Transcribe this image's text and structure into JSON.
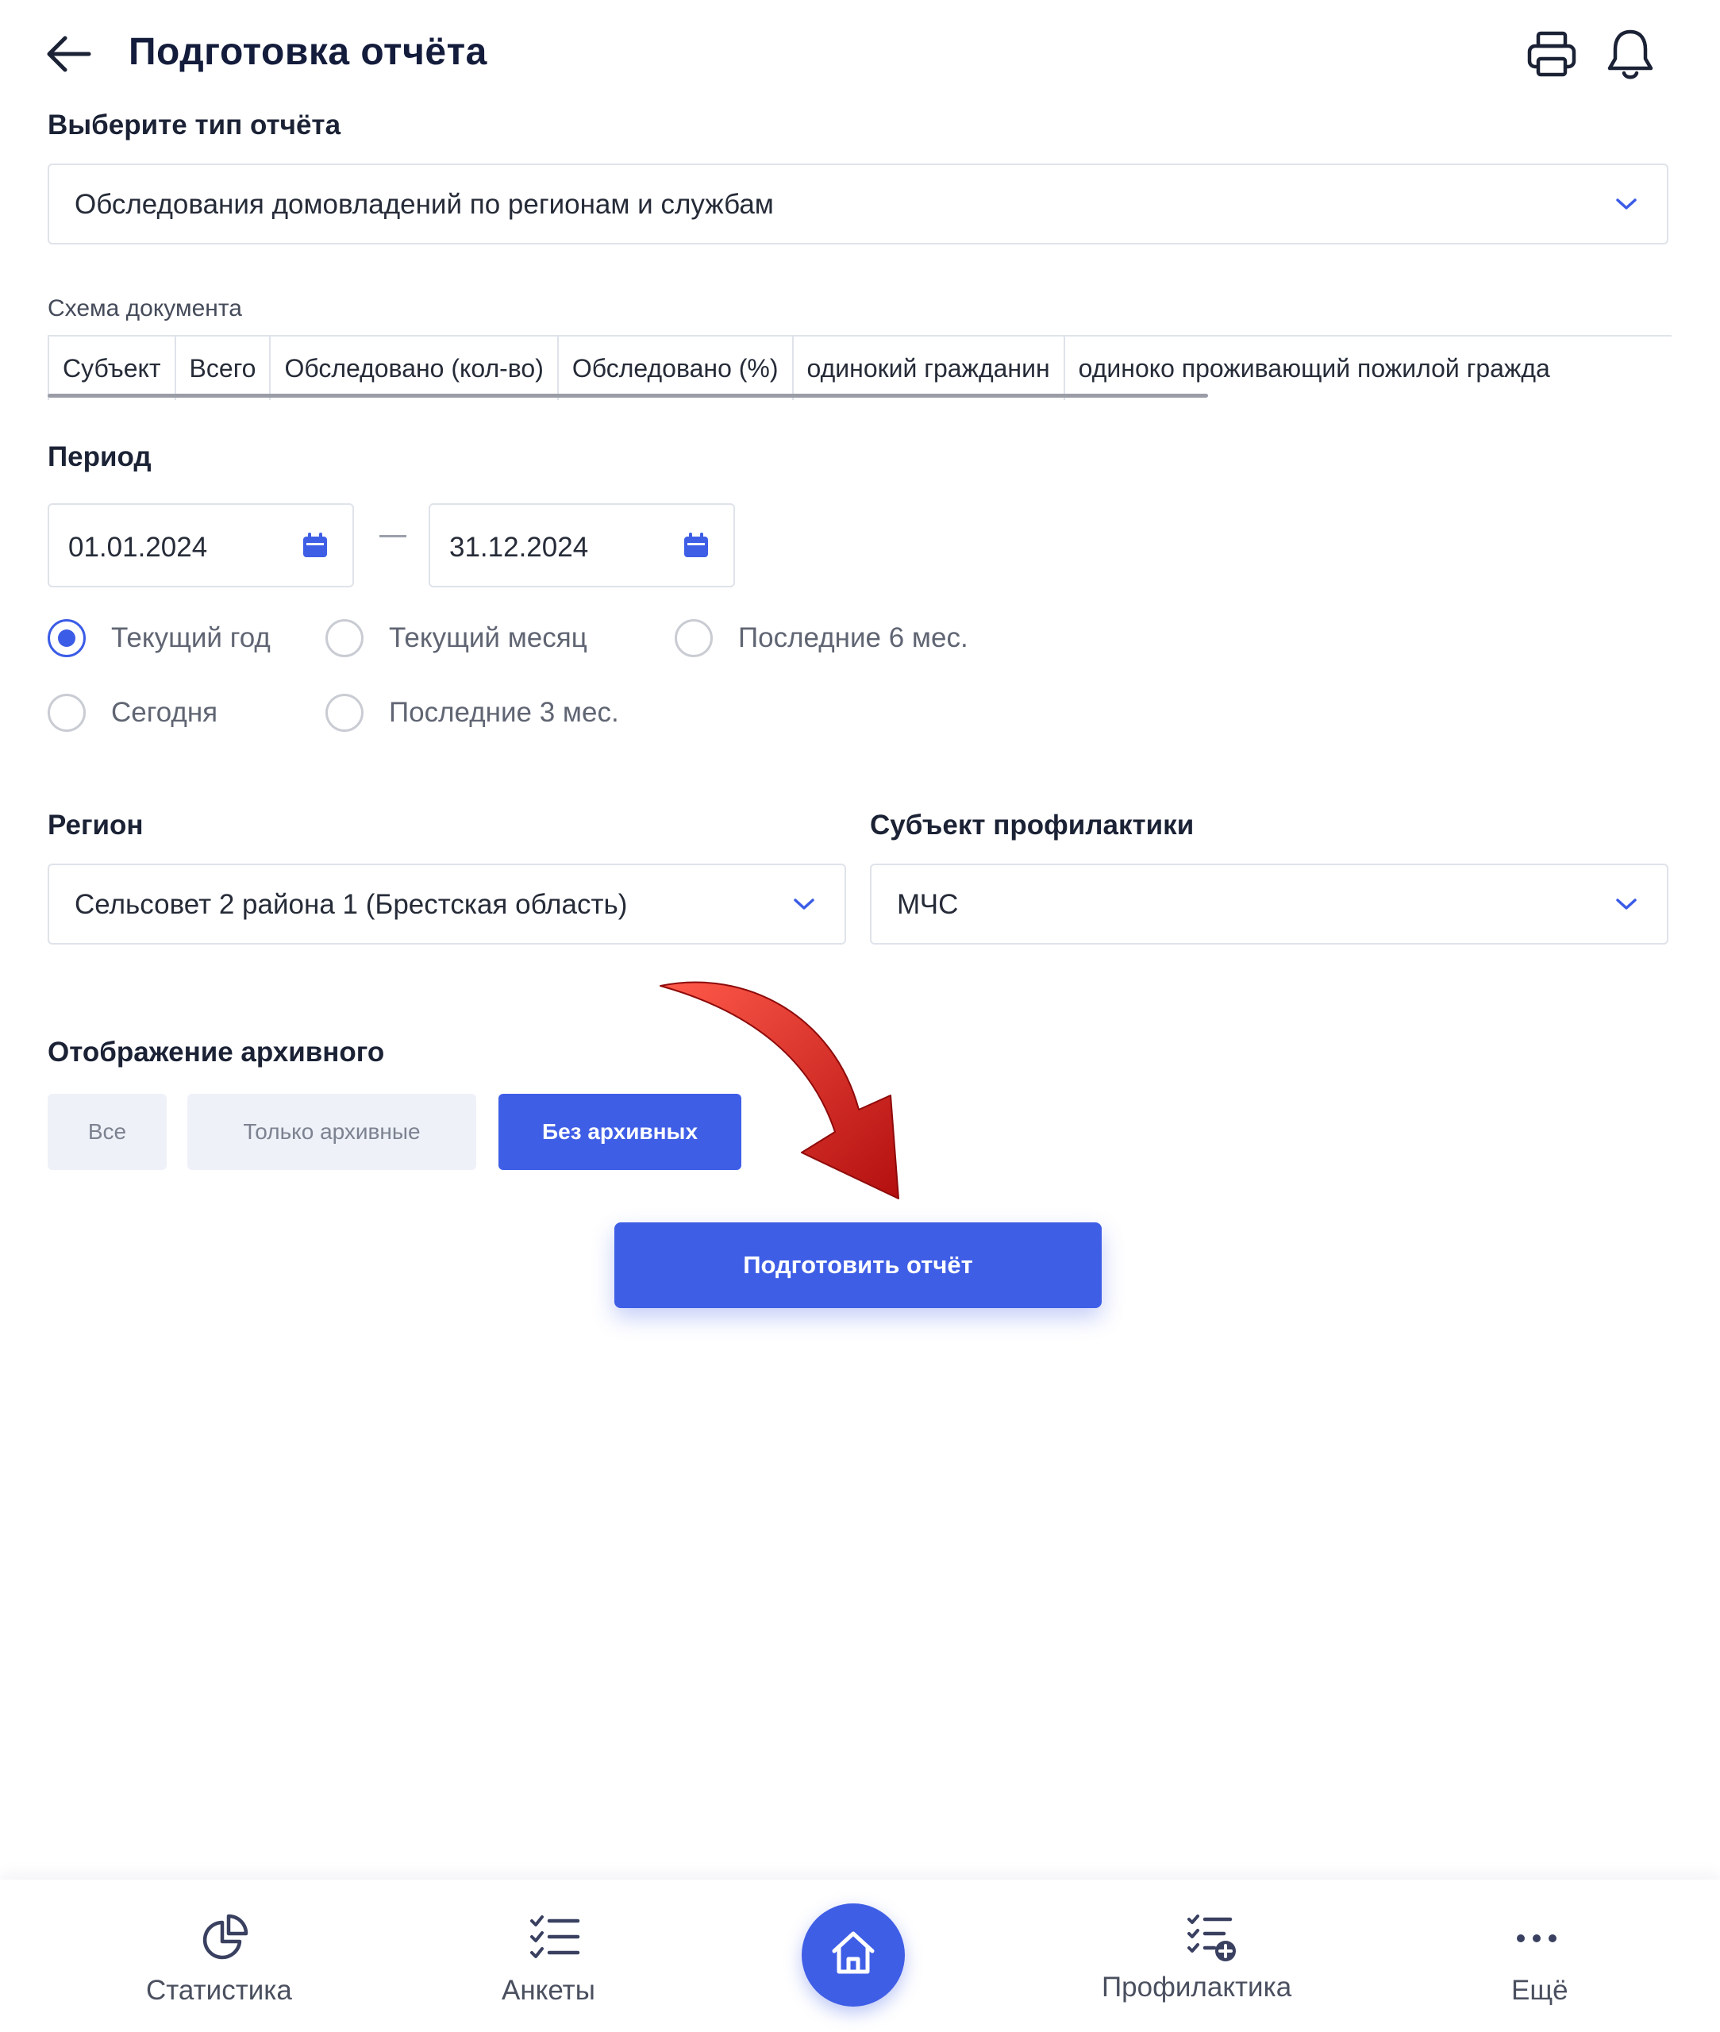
{
  "header": {
    "title": "Подготовка отчёта"
  },
  "report_type": {
    "label": "Выберите тип отчёта",
    "value": "Обследования домовладений по регионам и службам"
  },
  "schema": {
    "label": "Схема документа",
    "columns": [
      "Субъект",
      "Всего",
      "Обследовано (кол-во)",
      "Обследовано (%)",
      "одинокий гражданин",
      "одиноко проживающий пожилой гражда"
    ]
  },
  "period": {
    "label": "Период",
    "from": "01.01.2024",
    "to": "31.12.2024",
    "options": [
      "Текущий год",
      "Текущий месяц",
      "Последние 6 мес.",
      "Сегодня",
      "Последние 3 мес."
    ],
    "selected": "Текущий год"
  },
  "region": {
    "label": "Регион",
    "value": "Сельсовет 2 района 1 (Брестская область)"
  },
  "subject": {
    "label": "Субъект профилактики",
    "value": "МЧС"
  },
  "archive": {
    "label": "Отображение архивного",
    "options": [
      "Все",
      "Только архивные",
      "Без архивных"
    ],
    "selected": "Без архивных"
  },
  "submit_label": "Подготовить отчёт",
  "bottom_nav": {
    "items": [
      "Статистика",
      "Анкеты",
      "Профилактика",
      "Ещё"
    ]
  },
  "colors": {
    "accent": "#3f5ee6",
    "arrow": "#d81e1e"
  }
}
